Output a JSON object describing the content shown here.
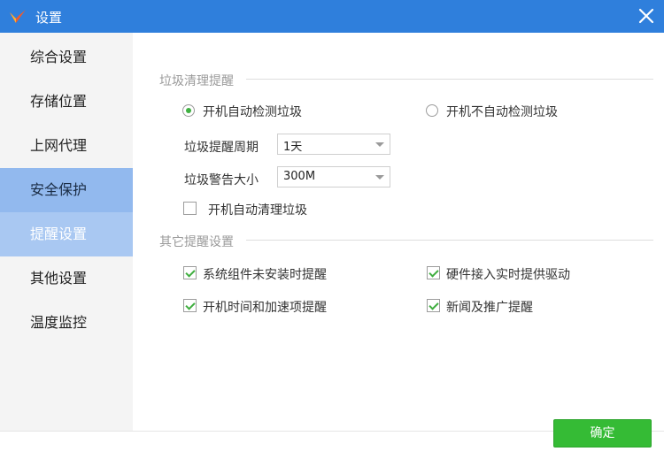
{
  "window": {
    "title": "设置",
    "close_icon": "close-icon",
    "logo_icon": "app-logo-icon"
  },
  "sidebar": {
    "items": [
      {
        "label": "综合设置",
        "state": "normal"
      },
      {
        "label": "存储位置",
        "state": "normal"
      },
      {
        "label": "上网代理",
        "state": "normal"
      },
      {
        "label": "安全保护",
        "state": "hover"
      },
      {
        "label": "提醒设置",
        "state": "selected"
      },
      {
        "label": "其他设置",
        "state": "normal"
      },
      {
        "label": "温度监控",
        "state": "normal"
      }
    ]
  },
  "junk": {
    "section_title": "垃圾清理提醒",
    "radio_auto": {
      "label": "开机自动检测垃圾",
      "checked": true
    },
    "radio_manual": {
      "label": "开机不自动检测垃圾",
      "checked": false
    },
    "period": {
      "label": "垃圾提醒周期",
      "value": "1天"
    },
    "size": {
      "label": "垃圾警告大小",
      "value": "300M"
    },
    "auto_clean": {
      "label": "开机自动清理垃圾",
      "checked": false
    }
  },
  "other": {
    "section_title": "其它提醒设置",
    "options": [
      {
        "label": "系统组件未安装时提醒",
        "checked": true
      },
      {
        "label": "硬件接入实时提供驱动",
        "checked": true
      },
      {
        "label": "开机时间和加速项提醒",
        "checked": true
      },
      {
        "label": "新闻及推广提醒",
        "checked": true
      }
    ]
  },
  "buttons": {
    "ok_label": "确定"
  },
  "colors": {
    "titlebar": "#2f7fdc",
    "sidebar_selected": "#a9c8f2",
    "sidebar_hover": "#92b9ee",
    "ok_button": "#35bb35",
    "check_green": "#3fae3f"
  }
}
